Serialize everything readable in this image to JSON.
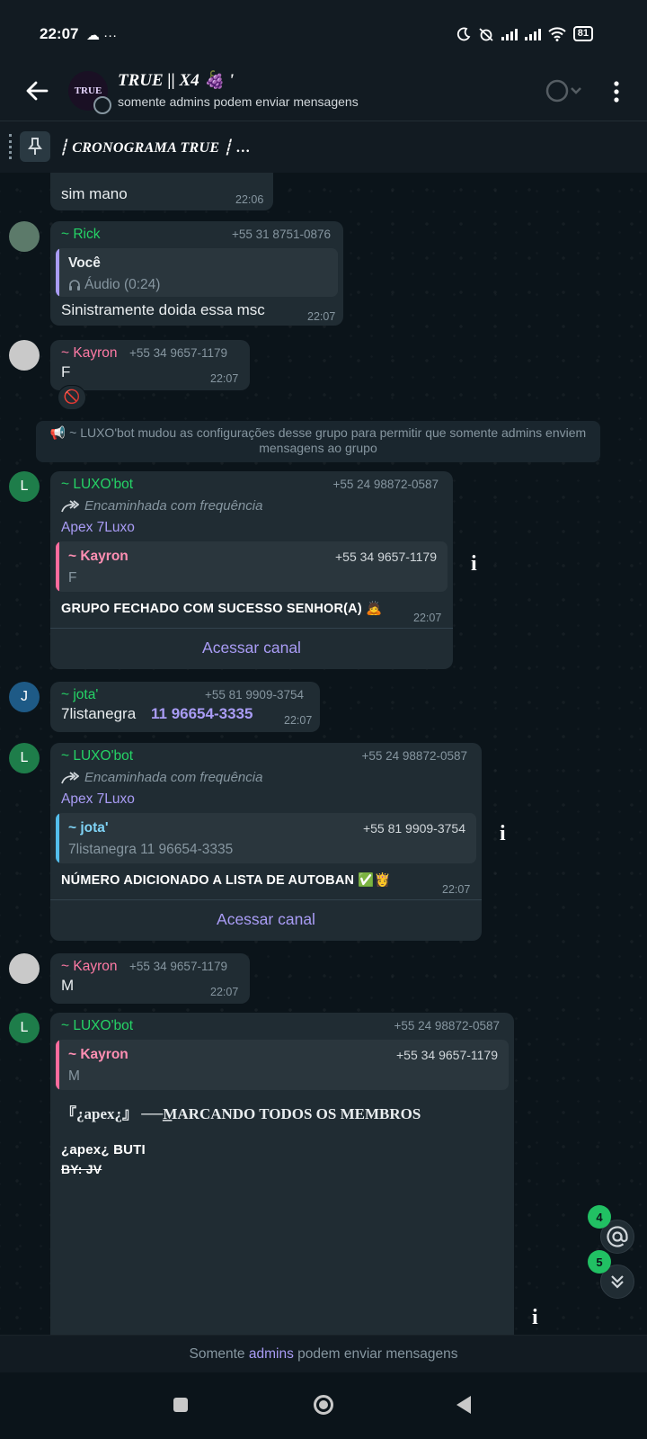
{
  "status_bar": {
    "time": "22:07",
    "left_icons": "☁ ···",
    "battery": "81"
  },
  "header": {
    "title": "TRUE || X4 🍇 '",
    "subtitle": "somente admins podem enviar mensagens",
    "avatar_text": "TRUE"
  },
  "pinned": {
    "text": "┊ CRONOGRAMA TRUE ┊ …"
  },
  "messages": [
    {
      "text": "sim mano",
      "time": "22:06"
    },
    {
      "sender": "~ Rick",
      "phone": "+55 31 8751-0876",
      "quote_name": "Você",
      "quote_text": "Áudio (0:24)",
      "text": "Sinistramente doida essa msc",
      "time": "22:07"
    },
    {
      "sender": "~ Kayron",
      "phone": "+55 34 9657-1179",
      "text": "F",
      "time": "22:07",
      "reaction": "🚫"
    },
    {
      "sender": "~ LUXO'bot",
      "phone": "+55 24 98872-0587",
      "avatar": "L",
      "forwarded": "Encaminhada com frequência",
      "channel": "Apex 7Luxo",
      "quote_name": "~ Kayron",
      "quote_phone": "+55 34 9657-1179",
      "quote_text": "F",
      "text": "GRUPO FECHADO COM SUCESSO SENHOR(A) 🙇",
      "time": "22:07",
      "action": "Acessar canal"
    },
    {
      "sender": "~ jota'",
      "phone": "+55 81 9909-3754",
      "avatar": "J",
      "text": "7listanegra",
      "link": "11 96654-3335",
      "time": "22:07"
    },
    {
      "sender": "~ LUXO'bot",
      "phone": "+55 24 98872-0587",
      "avatar": "L",
      "forwarded": "Encaminhada com frequência",
      "channel": "Apex 7Luxo",
      "quote_name": "~ jota'",
      "quote_phone": "+55 81 9909-3754",
      "quote_text": "7listanegra 11 96654-3335",
      "text": "NÚMERO ADICIONADO A LISTA DE AUTOBAN ✅👸",
      "time": "22:07",
      "action": "Acessar canal"
    },
    {
      "sender": "~ Kayron",
      "phone": "+55 34 9657-1179",
      "text": "M",
      "time": "22:07"
    },
    {
      "sender": "~ LUXO'bot",
      "phone": "+55 24 98872-0587",
      "avatar": "L",
      "quote_name": "~ Kayron",
      "quote_phone": "+55 34 9657-1179",
      "quote_text": "M",
      "text": "『¿apex¿』 ──͟͟MARCANDO TODOS OS MEMBROS",
      "text2": "¿apex¿ BUTI",
      "text3": "BY: JV"
    }
  ],
  "system_message": "📢 ~ LUXO'bot mudou as configurações desse grupo para permitir que somente admins enviem mensagens ao grupo",
  "fabs": {
    "mentions_count": "4",
    "unread_count": "5"
  },
  "bottom_bar": {
    "prefix": "Somente",
    "link": "admins",
    "suffix": "podem enviar mensagens"
  },
  "colors": {
    "rick": "#25d366",
    "kayron": "#ff7aa5",
    "luxo": "#25d366",
    "jota": "#25d366",
    "voce_bar": "#a99cf5",
    "kayron_bar": "#ff6b9d",
    "jota_bar": "#53bdeb",
    "link": "#a99cf5"
  }
}
